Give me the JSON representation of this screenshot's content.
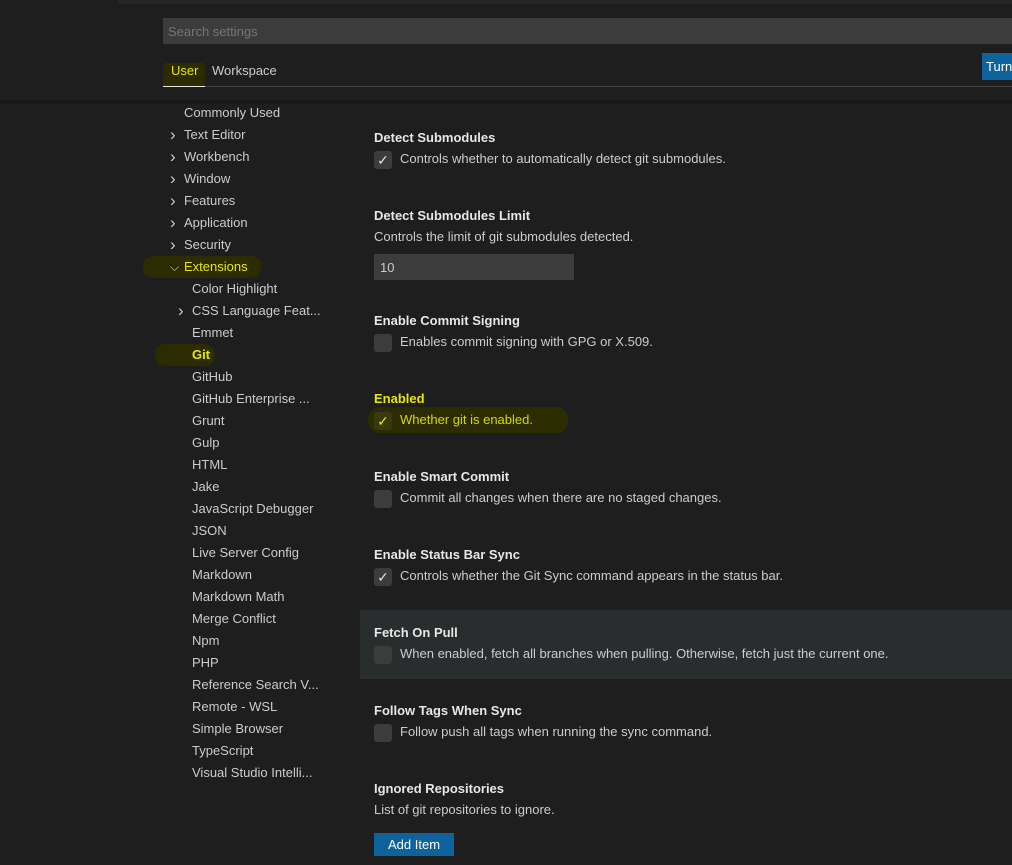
{
  "search": {
    "placeholder": "Search settings"
  },
  "tabs": [
    {
      "label": "User"
    },
    {
      "label": "Workspace"
    }
  ],
  "turn_button": "Turn",
  "sidebar": {
    "items": [
      {
        "label": "Commonly Used",
        "chevron": ""
      },
      {
        "label": "Text Editor",
        "chevron": "right"
      },
      {
        "label": "Workbench",
        "chevron": "right"
      },
      {
        "label": "Window",
        "chevron": "right"
      },
      {
        "label": "Features",
        "chevron": "right"
      },
      {
        "label": "Application",
        "chevron": "right"
      },
      {
        "label": "Security",
        "chevron": "right"
      },
      {
        "label": "Extensions",
        "chevron": "down"
      },
      {
        "label": "Color Highlight",
        "chevron": ""
      },
      {
        "label": "CSS Language Feat...",
        "chevron": "right"
      },
      {
        "label": "Emmet",
        "chevron": ""
      },
      {
        "label": "Git",
        "chevron": ""
      },
      {
        "label": "GitHub",
        "chevron": ""
      },
      {
        "label": "GitHub Enterprise ...",
        "chevron": ""
      },
      {
        "label": "Grunt",
        "chevron": ""
      },
      {
        "label": "Gulp",
        "chevron": ""
      },
      {
        "label": "HTML",
        "chevron": ""
      },
      {
        "label": "Jake",
        "chevron": ""
      },
      {
        "label": "JavaScript Debugger",
        "chevron": ""
      },
      {
        "label": "JSON",
        "chevron": ""
      },
      {
        "label": "Live Server Config",
        "chevron": ""
      },
      {
        "label": "Markdown",
        "chevron": ""
      },
      {
        "label": "Markdown Math",
        "chevron": ""
      },
      {
        "label": "Merge Conflict",
        "chevron": ""
      },
      {
        "label": "Npm",
        "chevron": ""
      },
      {
        "label": "PHP",
        "chevron": ""
      },
      {
        "label": "Reference Search V...",
        "chevron": ""
      },
      {
        "label": "Remote - WSL",
        "chevron": ""
      },
      {
        "label": "Simple Browser",
        "chevron": ""
      },
      {
        "label": "TypeScript",
        "chevron": ""
      },
      {
        "label": "Visual Studio Intelli...",
        "chevron": ""
      }
    ]
  },
  "settings": [
    {
      "title": "Detect Submodules",
      "desc": "Controls whether to automatically detect git submodules.",
      "checked": true
    },
    {
      "title": "Detect Submodules Limit",
      "desc": "Controls the limit of git submodules detected.",
      "value": "10"
    },
    {
      "title": "Enable Commit Signing",
      "desc": "Enables commit signing with GPG or X.509.",
      "checked": false
    },
    {
      "title": "Enabled",
      "desc": "Whether git is enabled.",
      "checked": true
    },
    {
      "title": "Enable Smart Commit",
      "desc": "Commit all changes when there are no staged changes.",
      "checked": false
    },
    {
      "title": "Enable Status Bar Sync",
      "desc": "Controls whether the Git Sync command appears in the status bar.",
      "checked": true
    },
    {
      "title": "Fetch On Pull",
      "desc": "When enabled, fetch all branches when pulling. Otherwise, fetch just the current one.",
      "checked": false
    },
    {
      "title": "Follow Tags When Sync",
      "desc": "Follow push all tags when running the sync command.",
      "checked": false
    },
    {
      "title": "Ignored Repositories",
      "desc": "List of git repositories to ignore.",
      "button": "Add Item"
    }
  ]
}
